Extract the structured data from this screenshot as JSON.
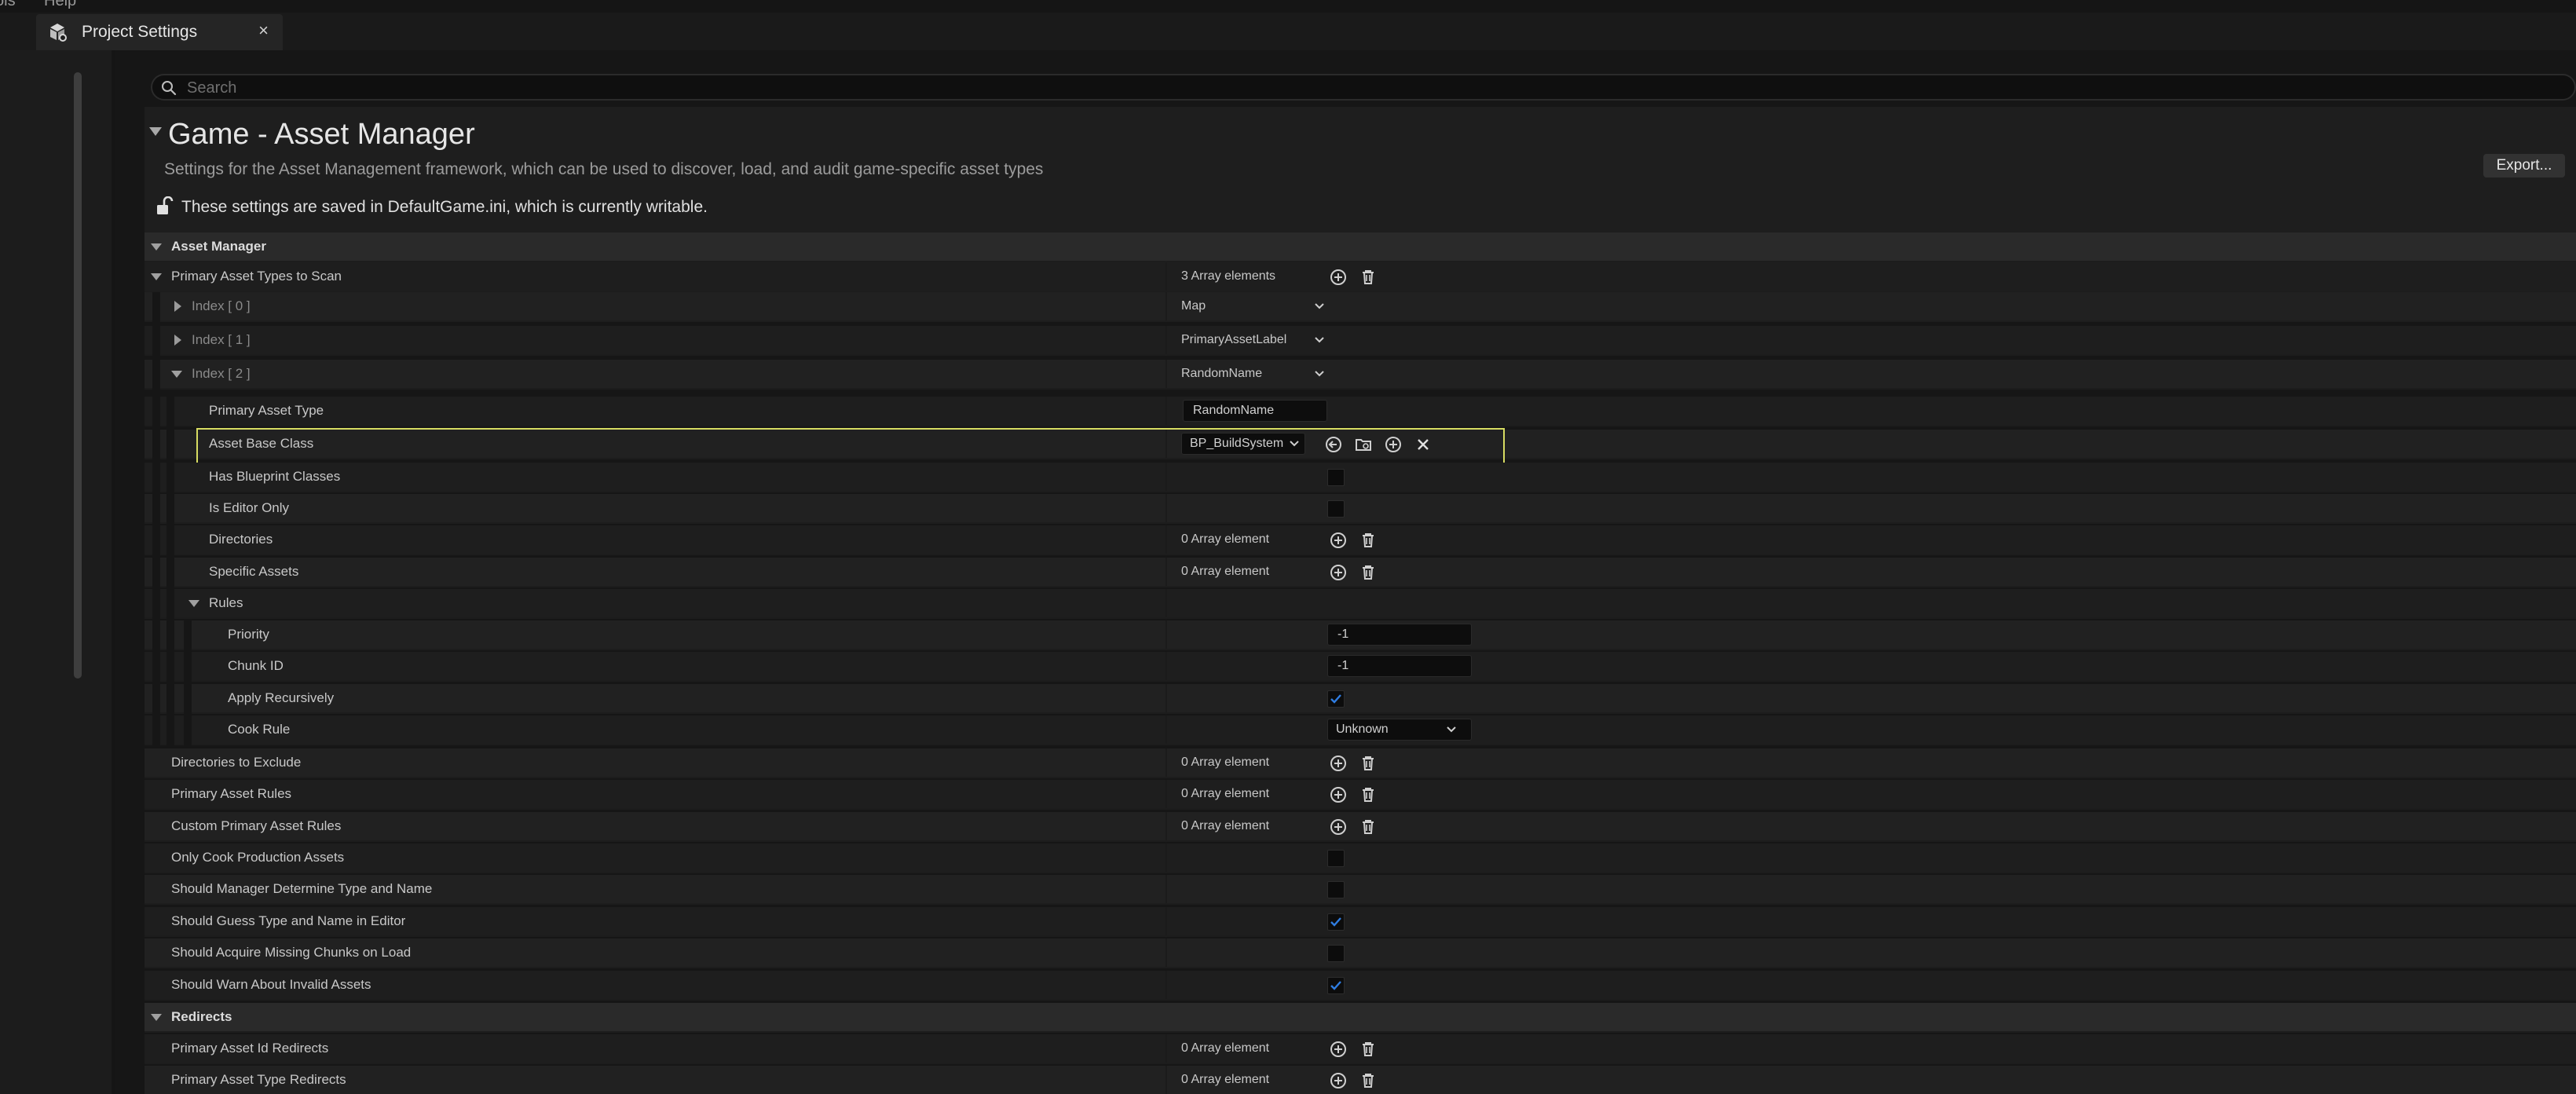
{
  "menubar": {
    "left_item": "ols",
    "help": "Help"
  },
  "tab": {
    "title": "Project Settings",
    "close": "×",
    "icon": "settings-cubes-icon"
  },
  "search": {
    "placeholder": "Search",
    "value": ""
  },
  "header": {
    "title": "Game - Asset Manager",
    "description": "Settings for the Asset Management framework, which can be used to discover, load, and audit game-specific asset types",
    "export_label": "Export...",
    "writable_note": "These settings are saved in DefaultGame.ini, which is currently writable."
  },
  "sections": {
    "asset_manager": "Asset Manager",
    "redirects": "Redirects"
  },
  "primary_asset_types": {
    "label": "Primary Asset Types to Scan",
    "count": "3 Array elements",
    "indices": [
      {
        "label": "Index [ 0 ]",
        "value": "Map"
      },
      {
        "label": "Index [ 1 ]",
        "value": "PrimaryAssetLabel"
      },
      {
        "label": "Index [ 2 ]",
        "value": "RandomName"
      }
    ],
    "index2": {
      "primary_asset_type_label": "Primary Asset Type",
      "primary_asset_type_value": "RandomName",
      "asset_base_class_label": "Asset Base Class",
      "asset_base_class_value": "BP_BuildSystem",
      "has_blueprint_classes_label": "Has Blueprint Classes",
      "has_blueprint_classes": false,
      "is_editor_only_label": "Is Editor Only",
      "is_editor_only": false,
      "directories_label": "Directories",
      "directories_count": "0 Array element",
      "specific_assets_label": "Specific Assets",
      "specific_assets_count": "0 Array element",
      "rules_label": "Rules",
      "priority_label": "Priority",
      "priority_value": "-1",
      "chunk_id_label": "Chunk ID",
      "chunk_id_value": "-1",
      "apply_recursively_label": "Apply Recursively",
      "apply_recursively": true,
      "cook_rule_label": "Cook Rule",
      "cook_rule_value": "Unknown"
    }
  },
  "other": {
    "directories_to_exclude_label": "Directories to Exclude",
    "directories_to_exclude_count": "0 Array element",
    "primary_asset_rules_label": "Primary Asset Rules",
    "primary_asset_rules_count": "0 Array element",
    "custom_primary_asset_rules_label": "Custom Primary Asset Rules",
    "custom_primary_asset_rules_count": "0 Array element",
    "only_cook_production_label": "Only Cook Production Assets",
    "only_cook_production": false,
    "should_manager_determine_label": "Should Manager Determine Type and Name",
    "should_manager_determine": false,
    "should_guess_type_label": "Should Guess Type and Name in Editor",
    "should_guess_type": true,
    "should_acquire_chunks_label": "Should Acquire Missing Chunks on Load",
    "should_acquire_chunks": false,
    "should_warn_invalid_label": "Should Warn About Invalid Assets",
    "should_warn_invalid": true
  },
  "redirects": {
    "primary_asset_id_label": "Primary Asset Id Redirects",
    "primary_asset_id_count": "0 Array element",
    "primary_asset_type_label": "Primary Asset Type Redirects",
    "primary_asset_type_count": "0 Array element"
  },
  "colors": {
    "accent_check": "#2f7de1",
    "highlight": "#d7dc62"
  }
}
